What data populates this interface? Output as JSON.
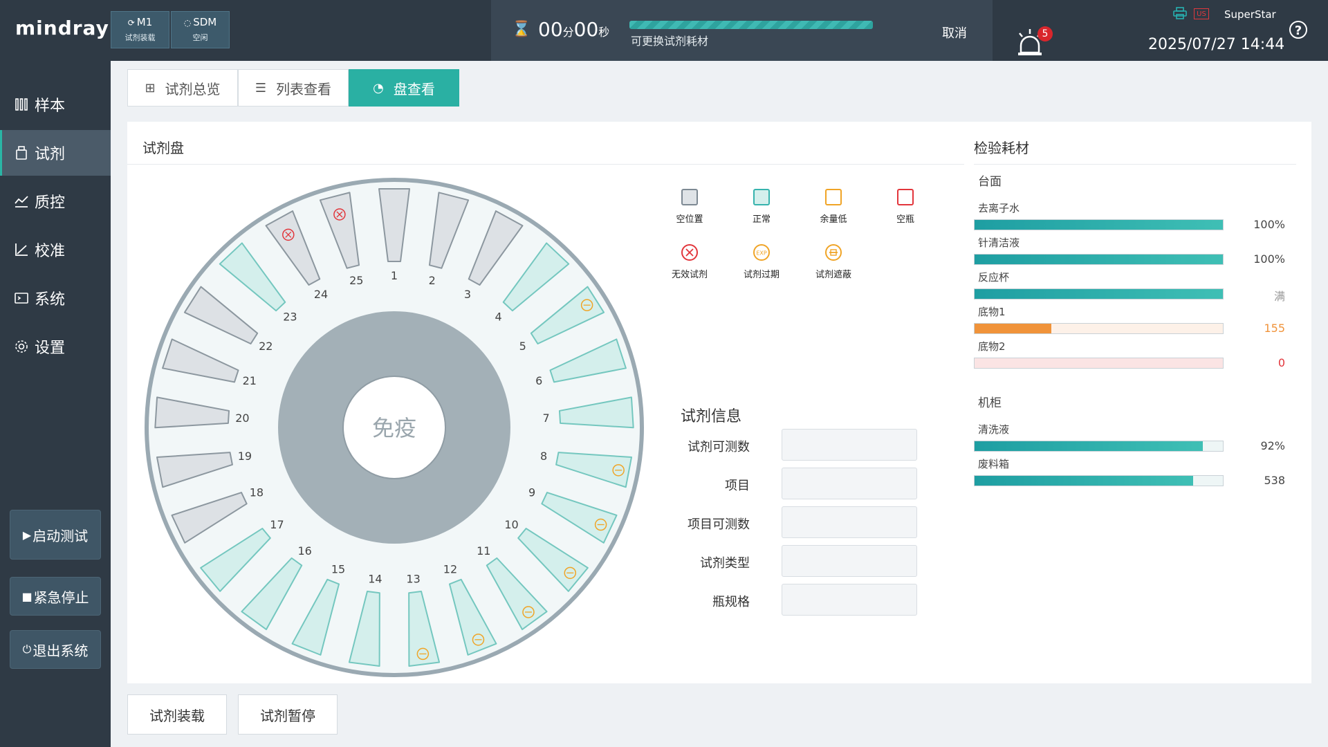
{
  "header": {
    "logo": "mindray",
    "modules": [
      {
        "name": "M1",
        "status": "试剂装载",
        "icon": "refresh-icon"
      },
      {
        "name": "SDM",
        "status": "空闲",
        "icon": "check-circle-icon"
      }
    ],
    "timer": {
      "min": "00",
      "min_unit": "分",
      "sec": "00",
      "sec_unit": "秒",
      "label": "可更换试剂耗材"
    },
    "cancel": "取消",
    "alarm_count": "5",
    "us_badge": "US",
    "user": "SuperStar",
    "datetime": "2025/07/27 14:44",
    "help": "?"
  },
  "sidebar": {
    "items": [
      {
        "label": "样本",
        "icon": "sample-rack-icon"
      },
      {
        "label": "试剂",
        "icon": "reagent-bottle-icon"
      },
      {
        "label": "质控",
        "icon": "qc-chart-icon"
      },
      {
        "label": "校准",
        "icon": "calibration-icon"
      },
      {
        "label": "系统",
        "icon": "system-icon"
      },
      {
        "label": "设置",
        "icon": "gear-icon"
      }
    ],
    "active_index": 1,
    "start_test": "启动测试",
    "emergency_stop": "紧急停止",
    "exit_system": "退出系统"
  },
  "tabs": [
    {
      "label": "试剂总览",
      "icon": "grid-icon"
    },
    {
      "label": "列表查看",
      "icon": "list-icon"
    },
    {
      "label": "盘查看",
      "icon": "disc-icon"
    }
  ],
  "active_tab": 2,
  "tray": {
    "title": "试剂盘",
    "center_label": "免疫",
    "positions": [
      {
        "n": "1",
        "state": "empty"
      },
      {
        "n": "2",
        "state": "empty"
      },
      {
        "n": "3",
        "state": "empty"
      },
      {
        "n": "4",
        "state": "normal"
      },
      {
        "n": "5",
        "state": "normal",
        "mark": "mask"
      },
      {
        "n": "6",
        "state": "normal"
      },
      {
        "n": "7",
        "state": "normal"
      },
      {
        "n": "8",
        "state": "normal",
        "mark": "mask"
      },
      {
        "n": "9",
        "state": "normal",
        "mark": "mask"
      },
      {
        "n": "10",
        "state": "normal",
        "mark": "exp"
      },
      {
        "n": "11",
        "state": "normal",
        "mark": "exp"
      },
      {
        "n": "12",
        "state": "normal",
        "mark": "exp"
      },
      {
        "n": "13",
        "state": "normal",
        "mark": "exp"
      },
      {
        "n": "14",
        "state": "normal"
      },
      {
        "n": "15",
        "state": "normal"
      },
      {
        "n": "16",
        "state": "normal"
      },
      {
        "n": "17",
        "state": "normal"
      },
      {
        "n": "18",
        "state": "empty"
      },
      {
        "n": "19",
        "state": "empty"
      },
      {
        "n": "20",
        "state": "empty"
      },
      {
        "n": "21",
        "state": "empty"
      },
      {
        "n": "22",
        "state": "empty"
      },
      {
        "n": "23",
        "state": "normal"
      },
      {
        "n": "24",
        "state": "empty",
        "mark": "invalid"
      },
      {
        "n": "25",
        "state": "empty",
        "mark": "invalid"
      }
    ]
  },
  "legend": [
    {
      "label": "空位置",
      "kind": "empty",
      "color": "#7d8993"
    },
    {
      "label": "正常",
      "kind": "normal",
      "color": "#36b3ad"
    },
    {
      "label": "余量低",
      "kind": "low",
      "color": "#f0a426"
    },
    {
      "label": "空瓶",
      "kind": "emptybottle",
      "color": "#e2353b"
    },
    {
      "label": "无效试剂",
      "kind": "invalid",
      "color": "#e2353b"
    },
    {
      "label": "试剂过期",
      "kind": "exp",
      "color": "#f0a426"
    },
    {
      "label": "试剂遮蔽",
      "kind": "mask",
      "color": "#f0a426"
    }
  ],
  "reagent_info": {
    "title": "试剂信息",
    "fields": [
      {
        "label": "试剂可测数",
        "value": ""
      },
      {
        "label": "项目",
        "value": ""
      },
      {
        "label": "项目可测数",
        "value": ""
      },
      {
        "label": "试剂类型",
        "value": ""
      },
      {
        "label": "瓶规格",
        "value": ""
      }
    ]
  },
  "consumables": {
    "title": "检验耗材",
    "bench_title": "台面",
    "bench": [
      {
        "label": "去离子水",
        "value": "100%",
        "level": 100,
        "color": "#444"
      },
      {
        "label": "针清洁液",
        "value": "100%",
        "level": 100,
        "color": "#444"
      },
      {
        "label": "反应杯",
        "value": "满",
        "level": 100,
        "color": "#999"
      },
      {
        "label": "底物1",
        "value": "155",
        "level": 31,
        "color": "#f0933a",
        "fill": "#f0933a",
        "track": "#fdf1e8"
      },
      {
        "label": "底物2",
        "value": "0",
        "level": 0,
        "color": "#e2353b",
        "track": "#fbe4e4"
      }
    ],
    "cabinet_title": "机柜",
    "cabinet": [
      {
        "label": "清洗液",
        "value": "92%",
        "level": 92,
        "color": "#444"
      },
      {
        "label": "废料箱",
        "value": "538",
        "level": 88,
        "color": "#444"
      }
    ]
  },
  "footer": {
    "load": "试剂装载",
    "pause": "试剂暂停"
  }
}
